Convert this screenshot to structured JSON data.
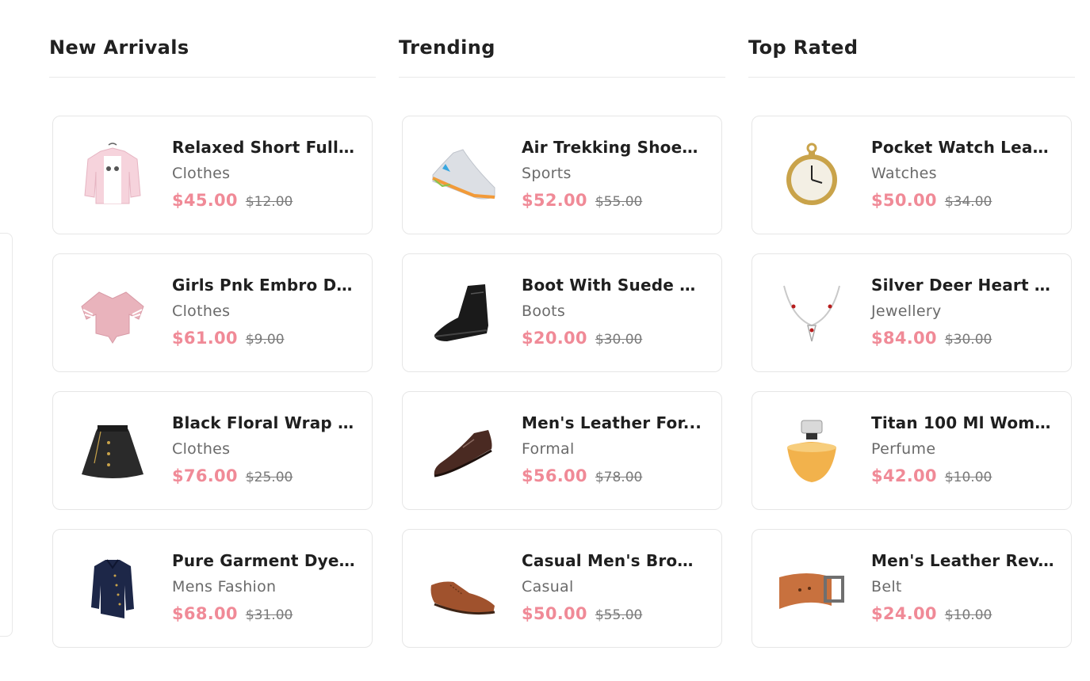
{
  "colors": {
    "price": "#f08a97",
    "old_price": "#7a7a7a",
    "border": "#e6e6e6"
  },
  "sections": [
    {
      "title": "New Arrivals",
      "products": [
        {
          "name": "Relaxed Short Full ...",
          "category": "Clothes",
          "price": "$45.00",
          "old_price": "$12.00",
          "icon": "sweatshirt-icon"
        },
        {
          "name": "Girls Pnk Embro De...",
          "category": "Clothes",
          "price": "$61.00",
          "old_price": "$9.00",
          "icon": "crop-top-icon"
        },
        {
          "name": "Black Floral Wrap ...",
          "category": "Clothes",
          "price": "$76.00",
          "old_price": "$25.00",
          "icon": "skirt-icon"
        },
        {
          "name": "Pure Garment Dye...",
          "category": "Mens Fashion",
          "price": "$68.00",
          "old_price": "$31.00",
          "icon": "shirt-icon"
        }
      ]
    },
    {
      "title": "Trending",
      "products": [
        {
          "name": "Air Trekking Shoes ...",
          "category": "Sports",
          "price": "$52.00",
          "old_price": "$55.00",
          "icon": "sneaker-icon"
        },
        {
          "name": "Boot With Suede D...",
          "category": "Boots",
          "price": "$20.00",
          "old_price": "$30.00",
          "icon": "boot-icon"
        },
        {
          "name": "Men's Leather For...",
          "category": "Formal",
          "price": "$56.00",
          "old_price": "$78.00",
          "icon": "formal-shoe-icon"
        },
        {
          "name": "Casual Men's Brow...",
          "category": "Casual",
          "price": "$50.00",
          "old_price": "$55.00",
          "icon": "brogue-shoe-icon"
        }
      ]
    },
    {
      "title": "Top Rated",
      "products": [
        {
          "name": "Pocket Watch Leat...",
          "category": "Watches",
          "price": "$50.00",
          "old_price": "$34.00",
          "icon": "pocket-watch-icon"
        },
        {
          "name": "Silver Deer Heart N...",
          "category": "Jewellery",
          "price": "$84.00",
          "old_price": "$30.00",
          "icon": "necklace-icon"
        },
        {
          "name": "Titan 100 Ml Wome...",
          "category": "Perfume",
          "price": "$42.00",
          "old_price": "$10.00",
          "icon": "perfume-icon"
        },
        {
          "name": "Men's Leather Rev...",
          "category": "Belt",
          "price": "$24.00",
          "old_price": "$10.00",
          "icon": "belt-icon"
        }
      ]
    }
  ]
}
